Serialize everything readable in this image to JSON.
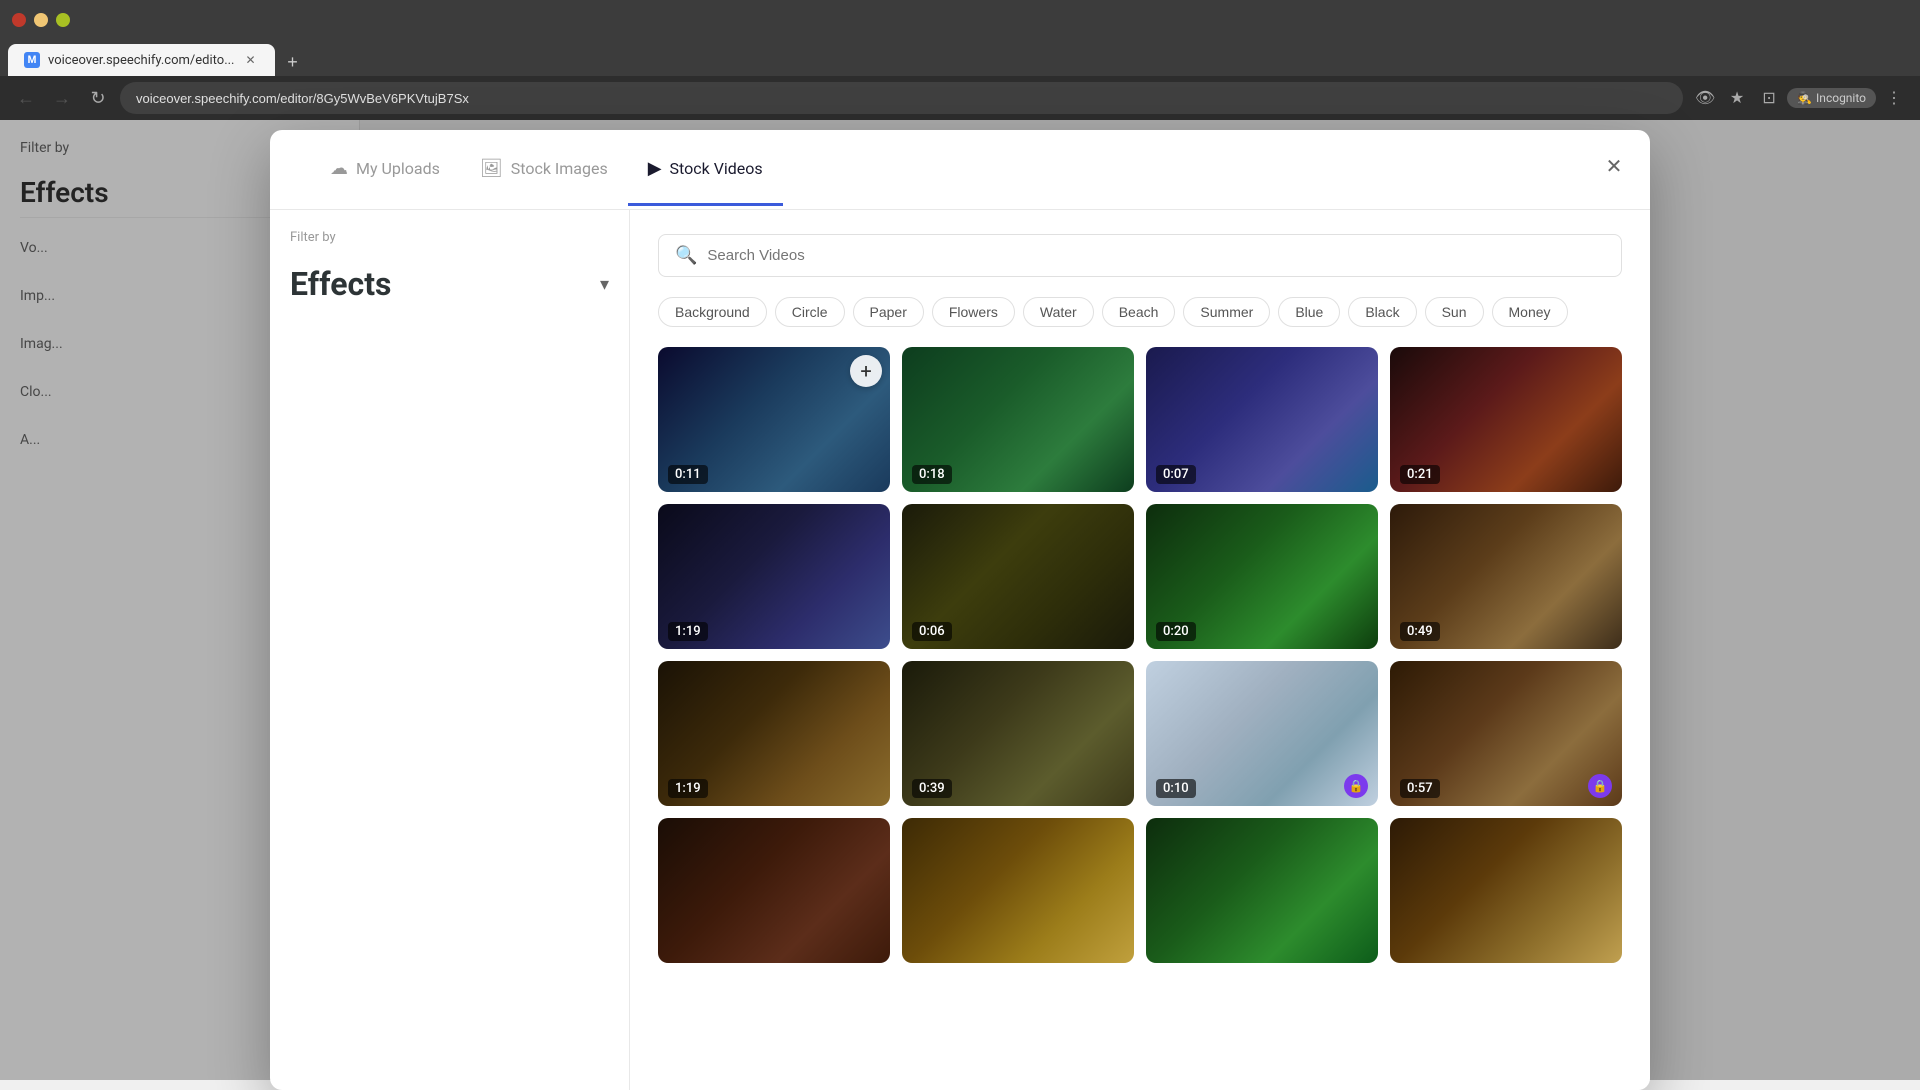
{
  "browser": {
    "url": "voiceover.speechify.com/editor/8Gy5WvBeV6PKVtujB7Sx",
    "tab_title": "voiceover.speechify.com/edito...",
    "incognito_label": "Incognito"
  },
  "modal": {
    "tabs": [
      {
        "id": "uploads",
        "label": "My Uploads",
        "icon": "☁"
      },
      {
        "id": "images",
        "label": "Stock Images",
        "icon": "🖼"
      },
      {
        "id": "videos",
        "label": "Stock Videos",
        "icon": "▶"
      }
    ],
    "active_tab": "videos",
    "search_placeholder": "Search Videos",
    "filter_label": "Filter by",
    "effects_label": "Effects",
    "tags": [
      "Background",
      "Circle",
      "Paper",
      "Flowers",
      "Water",
      "Beach",
      "Summer",
      "Blue",
      "Black",
      "Sun",
      "Money"
    ],
    "videos": [
      {
        "id": 1,
        "duration": "0:11",
        "locked": false,
        "thumb_class": "thumb-1"
      },
      {
        "id": 2,
        "duration": "0:18",
        "locked": false,
        "thumb_class": "thumb-2"
      },
      {
        "id": 3,
        "duration": "0:07",
        "locked": false,
        "thumb_class": "thumb-3"
      },
      {
        "id": 4,
        "duration": "0:21",
        "locked": false,
        "thumb_class": "thumb-4"
      },
      {
        "id": 5,
        "duration": "1:19",
        "locked": false,
        "thumb_class": "thumb-5"
      },
      {
        "id": 6,
        "duration": "0:06",
        "locked": false,
        "thumb_class": "thumb-6"
      },
      {
        "id": 7,
        "duration": "0:20",
        "locked": false,
        "thumb_class": "thumb-7"
      },
      {
        "id": 8,
        "duration": "0:49",
        "locked": false,
        "thumb_class": "thumb-8"
      },
      {
        "id": 9,
        "duration": "1:19",
        "locked": false,
        "thumb_class": "thumb-9"
      },
      {
        "id": 10,
        "duration": "0:39",
        "locked": false,
        "thumb_class": "thumb-10"
      },
      {
        "id": 11,
        "duration": "0:10",
        "locked": true,
        "thumb_class": "thumb-11"
      },
      {
        "id": 12,
        "duration": "0:57",
        "locked": true,
        "thumb_class": "thumb-12"
      },
      {
        "id": 13,
        "duration": "",
        "locked": false,
        "thumb_class": "thumb-13"
      },
      {
        "id": 14,
        "duration": "",
        "locked": false,
        "thumb_class": "thumb-14"
      },
      {
        "id": 15,
        "duration": "",
        "locked": false,
        "thumb_class": "thumb-15"
      },
      {
        "id": 16,
        "duration": "",
        "locked": false,
        "thumb_class": "thumb-16"
      }
    ],
    "sidebar_items": [
      "Vo...",
      "Imp...",
      "Imag...",
      "Clo...",
      "A..."
    ]
  },
  "colors": {
    "accent": "#3b5bdb",
    "lock_bg": "#7c3aed",
    "active_tab_border": "#3b5bdb"
  }
}
